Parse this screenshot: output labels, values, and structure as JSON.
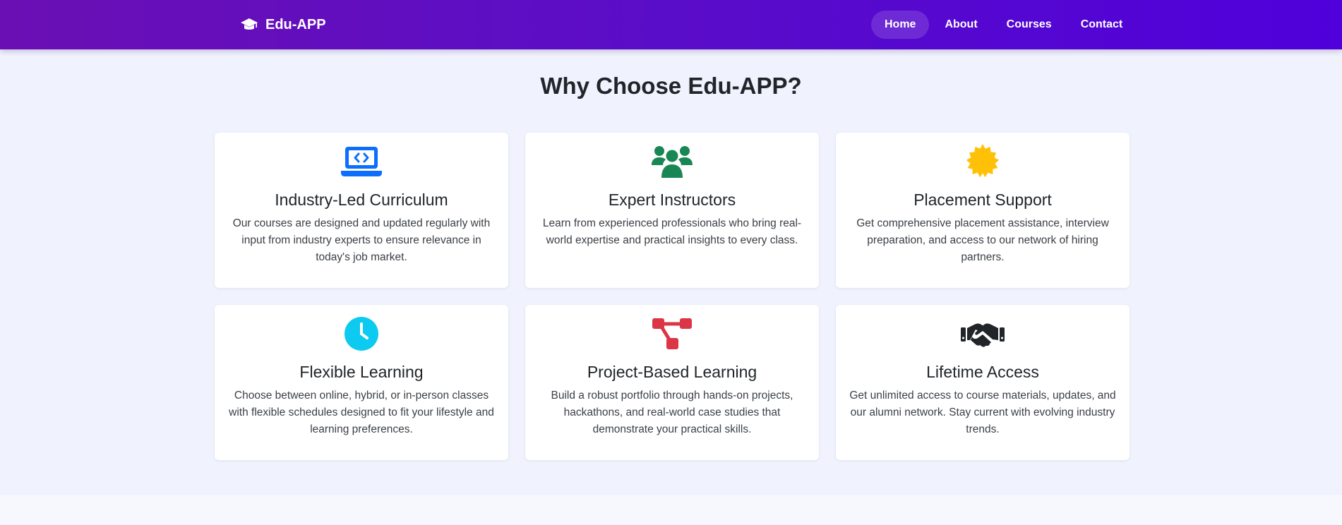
{
  "navbar": {
    "brand": "Edu-APP",
    "brand_icon": "graduation-cap-icon",
    "links": [
      {
        "label": "Home",
        "active": true
      },
      {
        "label": "About",
        "active": false
      },
      {
        "label": "Courses",
        "active": false
      },
      {
        "label": "Contact",
        "active": false
      }
    ]
  },
  "section": {
    "title": "Why Choose Edu-APP?"
  },
  "features": [
    {
      "icon": "laptop-code-icon",
      "icon_color": "#0d6efd",
      "title": "Industry-Led Curriculum",
      "description": "Our courses are designed and updated regularly with input from industry experts to ensure relevance in today's job market."
    },
    {
      "icon": "users-icon",
      "icon_color": "#198754",
      "title": "Expert Instructors",
      "description": "Learn from experienced professionals who bring real-world expertise and practical insights to every class."
    },
    {
      "icon": "award-seal-icon",
      "icon_color": "#ffc107",
      "title": "Placement Support",
      "description": "Get comprehensive placement assistance, interview preparation, and access to our network of hiring partners."
    },
    {
      "icon": "clock-icon",
      "icon_color": "#0dcaf0",
      "title": "Flexible Learning",
      "description": "Choose between online, hybrid, or in-person classes with flexible schedules designed to fit your lifestyle and learning preferences."
    },
    {
      "icon": "diagram-project-icon",
      "icon_color": "#dc3545",
      "title": "Project-Based Learning",
      "description": "Build a robust portfolio through hands-on projects, hackathons, and real-world case studies that demonstrate your practical skills."
    },
    {
      "icon": "handshake-icon",
      "icon_color": "#212529",
      "title": "Lifetime Access",
      "description": "Get unlimited access to course materials, updates, and our alumni network. Stay current with evolving industry trends."
    }
  ]
}
